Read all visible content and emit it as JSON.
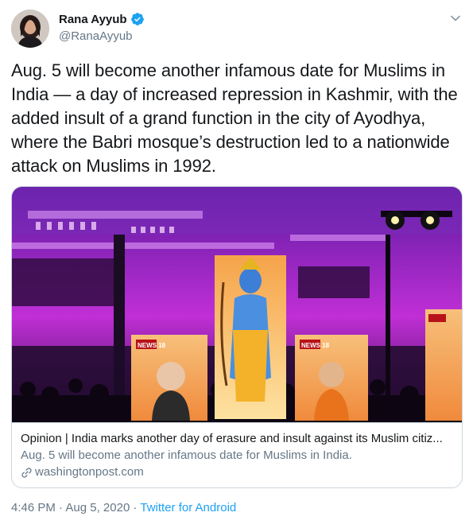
{
  "user": {
    "display_name": "Rana Ayyub",
    "handle": "@RanaAyyub",
    "verified": true
  },
  "tweet": {
    "text": "Aug. 5 will become another infamous date for Muslims in India — a day of increased repression in Kashmir, with the added insult of a grand function in the city of Ayodhya, where the Babri mosque’s destruction led to a nationwide attack on Muslims in 1992."
  },
  "card": {
    "title": "Opinion | India marks another day of erasure and insult against its Muslim citiz...",
    "description": "Aug. 5 will become another infamous date for Muslims in India.",
    "domain": "washingtonpost.com",
    "billboard_brand": "NEWS 18"
  },
  "footer": {
    "time": "4:46 PM",
    "separator": " · ",
    "date": "Aug 5, 2020",
    "source": "Twitter for Android"
  },
  "colors": {
    "accent": "#1da1f2",
    "secondary_text": "#657786",
    "border": "#ccd6dd"
  }
}
